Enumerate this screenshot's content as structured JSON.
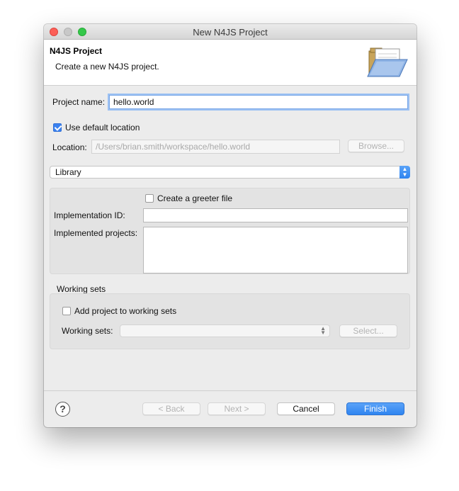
{
  "window": {
    "title": "New N4JS Project"
  },
  "banner": {
    "title": "N4JS Project",
    "description": "Create a new N4JS project.",
    "icon": "open-folder-icon"
  },
  "form": {
    "project_name_label": "Project name:",
    "project_name_value": "hello.world",
    "use_default_location_label": "Use default location",
    "use_default_location_checked": true,
    "location_label": "Location:",
    "location_value": "/Users/brian.smith/workspace/hello.world",
    "browse_label": "Browse...",
    "project_type_value": "Library"
  },
  "library_group": {
    "create_greeter_label": "Create a greeter file",
    "create_greeter_checked": false,
    "implementation_id_label": "Implementation ID:",
    "implementation_id_value": "",
    "implemented_projects_label": "Implemented projects:"
  },
  "working_sets": {
    "section_label": "Working sets",
    "add_label": "Add project to working sets",
    "add_checked": false,
    "working_sets_label": "Working sets:",
    "working_sets_value": "",
    "select_label": "Select..."
  },
  "footer": {
    "help_icon_glyph": "?",
    "back_label": "< Back",
    "next_label": "Next >",
    "cancel_label": "Cancel",
    "finish_label": "Finish"
  },
  "colors": {
    "accent": "#2f84f0",
    "close": "#fc5f57",
    "maximize": "#34c84a"
  }
}
